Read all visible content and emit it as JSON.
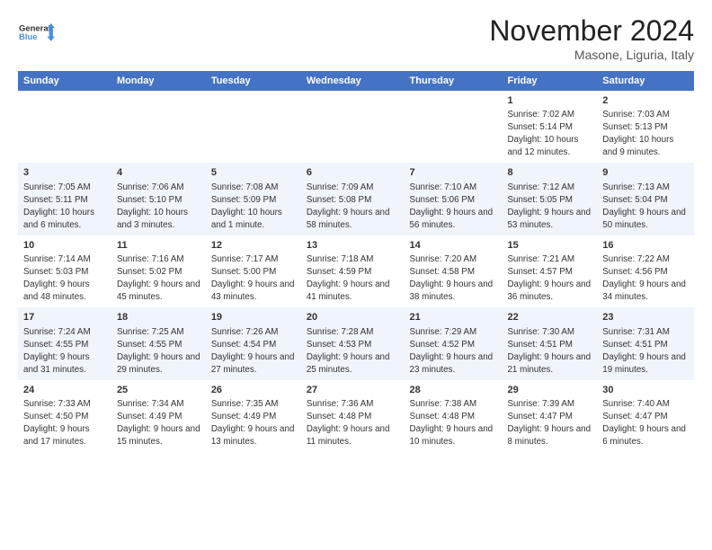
{
  "logo": {
    "line1": "General",
    "line2": "Blue"
  },
  "title": "November 2024",
  "subtitle": "Masone, Liguria, Italy",
  "days_of_week": [
    "Sunday",
    "Monday",
    "Tuesday",
    "Wednesday",
    "Thursday",
    "Friday",
    "Saturday"
  ],
  "weeks": [
    [
      {
        "day": "",
        "info": ""
      },
      {
        "day": "",
        "info": ""
      },
      {
        "day": "",
        "info": ""
      },
      {
        "day": "",
        "info": ""
      },
      {
        "day": "",
        "info": ""
      },
      {
        "day": "1",
        "info": "Sunrise: 7:02 AM\nSunset: 5:14 PM\nDaylight: 10 hours and 12 minutes."
      },
      {
        "day": "2",
        "info": "Sunrise: 7:03 AM\nSunset: 5:13 PM\nDaylight: 10 hours and 9 minutes."
      }
    ],
    [
      {
        "day": "3",
        "info": "Sunrise: 7:05 AM\nSunset: 5:11 PM\nDaylight: 10 hours and 6 minutes."
      },
      {
        "day": "4",
        "info": "Sunrise: 7:06 AM\nSunset: 5:10 PM\nDaylight: 10 hours and 3 minutes."
      },
      {
        "day": "5",
        "info": "Sunrise: 7:08 AM\nSunset: 5:09 PM\nDaylight: 10 hours and 1 minute."
      },
      {
        "day": "6",
        "info": "Sunrise: 7:09 AM\nSunset: 5:08 PM\nDaylight: 9 hours and 58 minutes."
      },
      {
        "day": "7",
        "info": "Sunrise: 7:10 AM\nSunset: 5:06 PM\nDaylight: 9 hours and 56 minutes."
      },
      {
        "day": "8",
        "info": "Sunrise: 7:12 AM\nSunset: 5:05 PM\nDaylight: 9 hours and 53 minutes."
      },
      {
        "day": "9",
        "info": "Sunrise: 7:13 AM\nSunset: 5:04 PM\nDaylight: 9 hours and 50 minutes."
      }
    ],
    [
      {
        "day": "10",
        "info": "Sunrise: 7:14 AM\nSunset: 5:03 PM\nDaylight: 9 hours and 48 minutes."
      },
      {
        "day": "11",
        "info": "Sunrise: 7:16 AM\nSunset: 5:02 PM\nDaylight: 9 hours and 45 minutes."
      },
      {
        "day": "12",
        "info": "Sunrise: 7:17 AM\nSunset: 5:00 PM\nDaylight: 9 hours and 43 minutes."
      },
      {
        "day": "13",
        "info": "Sunrise: 7:18 AM\nSunset: 4:59 PM\nDaylight: 9 hours and 41 minutes."
      },
      {
        "day": "14",
        "info": "Sunrise: 7:20 AM\nSunset: 4:58 PM\nDaylight: 9 hours and 38 minutes."
      },
      {
        "day": "15",
        "info": "Sunrise: 7:21 AM\nSunset: 4:57 PM\nDaylight: 9 hours and 36 minutes."
      },
      {
        "day": "16",
        "info": "Sunrise: 7:22 AM\nSunset: 4:56 PM\nDaylight: 9 hours and 34 minutes."
      }
    ],
    [
      {
        "day": "17",
        "info": "Sunrise: 7:24 AM\nSunset: 4:55 PM\nDaylight: 9 hours and 31 minutes."
      },
      {
        "day": "18",
        "info": "Sunrise: 7:25 AM\nSunset: 4:55 PM\nDaylight: 9 hours and 29 minutes."
      },
      {
        "day": "19",
        "info": "Sunrise: 7:26 AM\nSunset: 4:54 PM\nDaylight: 9 hours and 27 minutes."
      },
      {
        "day": "20",
        "info": "Sunrise: 7:28 AM\nSunset: 4:53 PM\nDaylight: 9 hours and 25 minutes."
      },
      {
        "day": "21",
        "info": "Sunrise: 7:29 AM\nSunset: 4:52 PM\nDaylight: 9 hours and 23 minutes."
      },
      {
        "day": "22",
        "info": "Sunrise: 7:30 AM\nSunset: 4:51 PM\nDaylight: 9 hours and 21 minutes."
      },
      {
        "day": "23",
        "info": "Sunrise: 7:31 AM\nSunset: 4:51 PM\nDaylight: 9 hours and 19 minutes."
      }
    ],
    [
      {
        "day": "24",
        "info": "Sunrise: 7:33 AM\nSunset: 4:50 PM\nDaylight: 9 hours and 17 minutes."
      },
      {
        "day": "25",
        "info": "Sunrise: 7:34 AM\nSunset: 4:49 PM\nDaylight: 9 hours and 15 minutes."
      },
      {
        "day": "26",
        "info": "Sunrise: 7:35 AM\nSunset: 4:49 PM\nDaylight: 9 hours and 13 minutes."
      },
      {
        "day": "27",
        "info": "Sunrise: 7:36 AM\nSunset: 4:48 PM\nDaylight: 9 hours and 11 minutes."
      },
      {
        "day": "28",
        "info": "Sunrise: 7:38 AM\nSunset: 4:48 PM\nDaylight: 9 hours and 10 minutes."
      },
      {
        "day": "29",
        "info": "Sunrise: 7:39 AM\nSunset: 4:47 PM\nDaylight: 9 hours and 8 minutes."
      },
      {
        "day": "30",
        "info": "Sunrise: 7:40 AM\nSunset: 4:47 PM\nDaylight: 9 hours and 6 minutes."
      }
    ]
  ]
}
